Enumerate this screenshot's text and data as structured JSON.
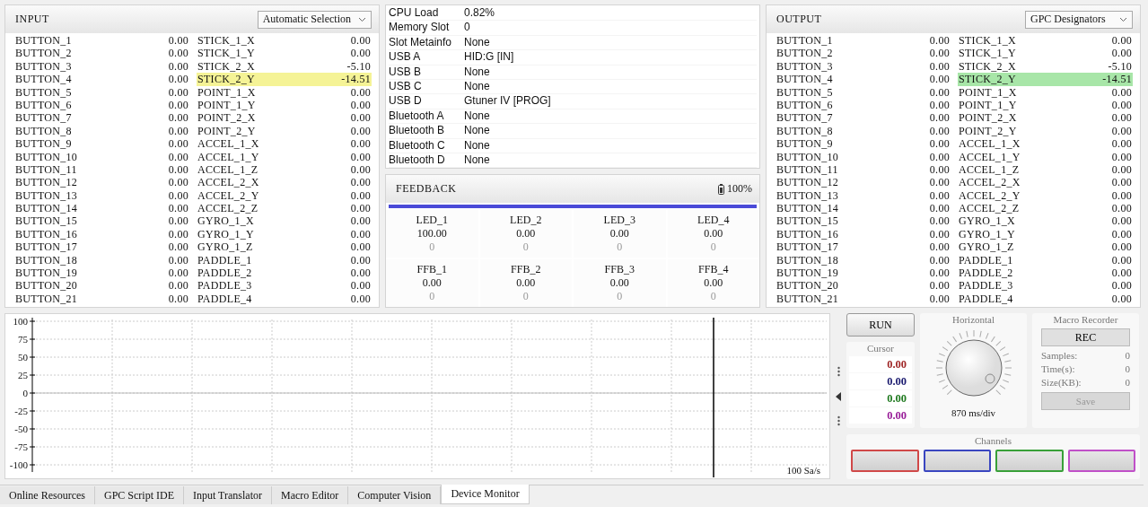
{
  "input": {
    "title": "INPUT",
    "kind": "input",
    "selector": "Automatic Selection",
    "buttons": [
      {
        "label": "BUTTON_1",
        "value": "0.00"
      },
      {
        "label": "BUTTON_2",
        "value": "0.00"
      },
      {
        "label": "BUTTON_3",
        "value": "0.00"
      },
      {
        "label": "BUTTON_4",
        "value": "0.00"
      },
      {
        "label": "BUTTON_5",
        "value": "0.00"
      },
      {
        "label": "BUTTON_6",
        "value": "0.00"
      },
      {
        "label": "BUTTON_7",
        "value": "0.00"
      },
      {
        "label": "BUTTON_8",
        "value": "0.00"
      },
      {
        "label": "BUTTON_9",
        "value": "0.00"
      },
      {
        "label": "BUTTON_10",
        "value": "0.00"
      },
      {
        "label": "BUTTON_11",
        "value": "0.00"
      },
      {
        "label": "BUTTON_12",
        "value": "0.00"
      },
      {
        "label": "BUTTON_13",
        "value": "0.00"
      },
      {
        "label": "BUTTON_14",
        "value": "0.00"
      },
      {
        "label": "BUTTON_15",
        "value": "0.00"
      },
      {
        "label": "BUTTON_16",
        "value": "0.00"
      },
      {
        "label": "BUTTON_17",
        "value": "0.00"
      },
      {
        "label": "BUTTON_18",
        "value": "0.00"
      },
      {
        "label": "BUTTON_19",
        "value": "0.00"
      },
      {
        "label": "BUTTON_20",
        "value": "0.00"
      },
      {
        "label": "BUTTON_21",
        "value": "0.00"
      }
    ],
    "axes": [
      {
        "label": "STICK_1_X",
        "value": "0.00",
        "active": false
      },
      {
        "label": "STICK_1_Y",
        "value": "0.00",
        "active": false
      },
      {
        "label": "STICK_2_X",
        "value": "-5.10",
        "active": false
      },
      {
        "label": "STICK_2_Y",
        "value": "-14.51",
        "active": true
      },
      {
        "label": "POINT_1_X",
        "value": "0.00",
        "active": false
      },
      {
        "label": "POINT_1_Y",
        "value": "0.00",
        "active": false
      },
      {
        "label": "POINT_2_X",
        "value": "0.00",
        "active": false
      },
      {
        "label": "POINT_2_Y",
        "value": "0.00",
        "active": false
      },
      {
        "label": "ACCEL_1_X",
        "value": "0.00",
        "active": false
      },
      {
        "label": "ACCEL_1_Y",
        "value": "0.00",
        "active": false
      },
      {
        "label": "ACCEL_1_Z",
        "value": "0.00",
        "active": false
      },
      {
        "label": "ACCEL_2_X",
        "value": "0.00",
        "active": false
      },
      {
        "label": "ACCEL_2_Y",
        "value": "0.00",
        "active": false
      },
      {
        "label": "ACCEL_2_Z",
        "value": "0.00",
        "active": false
      },
      {
        "label": "GYRO_1_X",
        "value": "0.00",
        "active": false
      },
      {
        "label": "GYRO_1_Y",
        "value": "0.00",
        "active": false
      },
      {
        "label": "GYRO_1_Z",
        "value": "0.00",
        "active": false
      },
      {
        "label": "PADDLE_1",
        "value": "0.00",
        "active": false
      },
      {
        "label": "PADDLE_2",
        "value": "0.00",
        "active": false
      },
      {
        "label": "PADDLE_3",
        "value": "0.00",
        "active": false
      },
      {
        "label": "PADDLE_4",
        "value": "0.00",
        "active": false
      }
    ]
  },
  "info": [
    {
      "label": "CPU Load",
      "value": "0.82%"
    },
    {
      "label": "Memory Slot",
      "value": "0"
    },
    {
      "label": "Slot Metainfo",
      "value": "None"
    },
    {
      "label": "USB A",
      "value": "HID:G [IN]"
    },
    {
      "label": "USB B",
      "value": "None"
    },
    {
      "label": "USB C",
      "value": "None"
    },
    {
      "label": "USB D",
      "value": "Gtuner IV [PROG]"
    },
    {
      "label": "Bluetooth A",
      "value": "None"
    },
    {
      "label": "Bluetooth B",
      "value": "None"
    },
    {
      "label": "Bluetooth C",
      "value": "None"
    },
    {
      "label": "Bluetooth D",
      "value": "None"
    }
  ],
  "feedback": {
    "title": "FEEDBACK",
    "battery": "100%",
    "cells": [
      {
        "label": "LED_1",
        "value": "100.00",
        "raw": "0"
      },
      {
        "label": "LED_2",
        "value": "0.00",
        "raw": "0"
      },
      {
        "label": "LED_3",
        "value": "0.00",
        "raw": "0"
      },
      {
        "label": "LED_4",
        "value": "0.00",
        "raw": "0"
      },
      {
        "label": "FFB_1",
        "value": "0.00",
        "raw": "0"
      },
      {
        "label": "FFB_2",
        "value": "0.00",
        "raw": "0"
      },
      {
        "label": "FFB_3",
        "value": "0.00",
        "raw": "0"
      },
      {
        "label": "FFB_4",
        "value": "0.00",
        "raw": "0"
      }
    ]
  },
  "output": {
    "title": "OUTPUT",
    "kind": "output",
    "selector": "GPC Designators",
    "buttons": [
      {
        "label": "BUTTON_1",
        "value": "0.00"
      },
      {
        "label": "BUTTON_2",
        "value": "0.00"
      },
      {
        "label": "BUTTON_3",
        "value": "0.00"
      },
      {
        "label": "BUTTON_4",
        "value": "0.00"
      },
      {
        "label": "BUTTON_5",
        "value": "0.00"
      },
      {
        "label": "BUTTON_6",
        "value": "0.00"
      },
      {
        "label": "BUTTON_7",
        "value": "0.00"
      },
      {
        "label": "BUTTON_8",
        "value": "0.00"
      },
      {
        "label": "BUTTON_9",
        "value": "0.00"
      },
      {
        "label": "BUTTON_10",
        "value": "0.00"
      },
      {
        "label": "BUTTON_11",
        "value": "0.00"
      },
      {
        "label": "BUTTON_12",
        "value": "0.00"
      },
      {
        "label": "BUTTON_13",
        "value": "0.00"
      },
      {
        "label": "BUTTON_14",
        "value": "0.00"
      },
      {
        "label": "BUTTON_15",
        "value": "0.00"
      },
      {
        "label": "BUTTON_16",
        "value": "0.00"
      },
      {
        "label": "BUTTON_17",
        "value": "0.00"
      },
      {
        "label": "BUTTON_18",
        "value": "0.00"
      },
      {
        "label": "BUTTON_19",
        "value": "0.00"
      },
      {
        "label": "BUTTON_20",
        "value": "0.00"
      },
      {
        "label": "BUTTON_21",
        "value": "0.00"
      }
    ],
    "axes": [
      {
        "label": "STICK_1_X",
        "value": "0.00",
        "active": false
      },
      {
        "label": "STICK_1_Y",
        "value": "0.00",
        "active": false
      },
      {
        "label": "STICK_2_X",
        "value": "-5.10",
        "active": false
      },
      {
        "label": "STICK_2_Y",
        "value": "-14.51",
        "active": true
      },
      {
        "label": "POINT_1_X",
        "value": "0.00",
        "active": false
      },
      {
        "label": "POINT_1_Y",
        "value": "0.00",
        "active": false
      },
      {
        "label": "POINT_2_X",
        "value": "0.00",
        "active": false
      },
      {
        "label": "POINT_2_Y",
        "value": "0.00",
        "active": false
      },
      {
        "label": "ACCEL_1_X",
        "value": "0.00",
        "active": false
      },
      {
        "label": "ACCEL_1_Y",
        "value": "0.00",
        "active": false
      },
      {
        "label": "ACCEL_1_Z",
        "value": "0.00",
        "active": false
      },
      {
        "label": "ACCEL_2_X",
        "value": "0.00",
        "active": false
      },
      {
        "label": "ACCEL_2_Y",
        "value": "0.00",
        "active": false
      },
      {
        "label": "ACCEL_2_Z",
        "value": "0.00",
        "active": false
      },
      {
        "label": "GYRO_1_X",
        "value": "0.00",
        "active": false
      },
      {
        "label": "GYRO_1_Y",
        "value": "0.00",
        "active": false
      },
      {
        "label": "GYRO_1_Z",
        "value": "0.00",
        "active": false
      },
      {
        "label": "PADDLE_1",
        "value": "0.00",
        "active": false
      },
      {
        "label": "PADDLE_2",
        "value": "0.00",
        "active": false
      },
      {
        "label": "PADDLE_3",
        "value": "0.00",
        "active": false
      },
      {
        "label": "PADDLE_4",
        "value": "0.00",
        "active": false
      }
    ]
  },
  "scope": {
    "y_ticks": [
      "100",
      "75",
      "50",
      "25",
      "0",
      "-25",
      "-50",
      "-75",
      "-100"
    ],
    "rate": "100 Sa/s"
  },
  "controls": {
    "run": "RUN",
    "cursor": {
      "title": "Cursor",
      "values": [
        {
          "value": "0.00",
          "color": "#a02828"
        },
        {
          "value": "0.00",
          "color": "#1c1c70"
        },
        {
          "value": "0.00",
          "color": "#207a20"
        },
        {
          "value": "0.00",
          "color": "#9a209a"
        }
      ]
    },
    "horizontal": {
      "title": "Horizontal",
      "reading": "870 ms/div"
    },
    "macro": {
      "title": "Macro Recorder",
      "rec": "REC",
      "stats": [
        {
          "label": "Samples:",
          "value": "0"
        },
        {
          "label": "Time(s):",
          "value": "0"
        },
        {
          "label": "Size(KB):",
          "value": "0"
        }
      ],
      "save": {
        "label": "Save",
        "disabled": true
      }
    },
    "channels": {
      "title": "Channels",
      "items": [
        {
          "color": "#d04848"
        },
        {
          "color": "#3a46c0"
        },
        {
          "color": "#38a038"
        },
        {
          "color": "#c050c8"
        }
      ]
    }
  },
  "tabs": [
    {
      "label": "Online Resources",
      "selected": false
    },
    {
      "label": "GPC Script IDE",
      "selected": false
    },
    {
      "label": "Input Translator",
      "selected": false
    },
    {
      "label": "Macro Editor",
      "selected": false
    },
    {
      "label": "Computer Vision",
      "selected": false
    },
    {
      "label": "Device Monitor",
      "selected": true
    }
  ]
}
